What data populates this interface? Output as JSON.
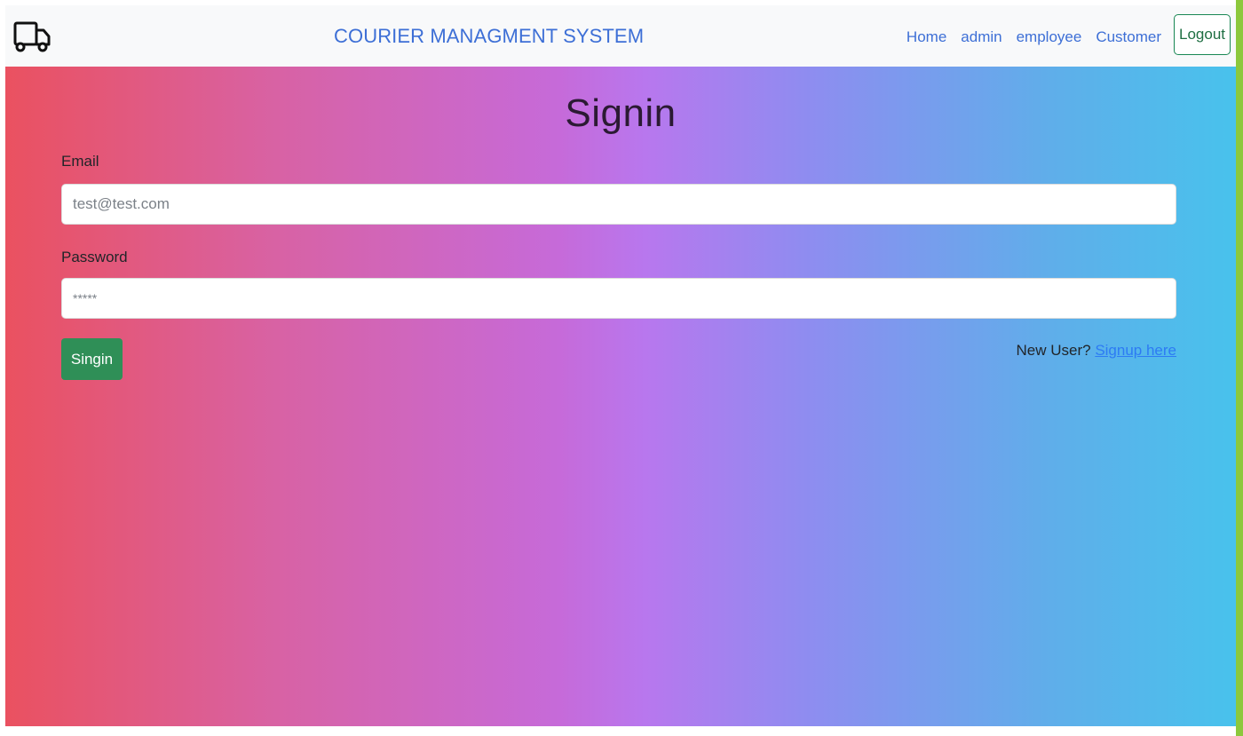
{
  "navbar": {
    "brand": "COURIER MANAGMENT SYSTEM",
    "links": [
      "Home",
      "admin",
      "employee",
      "Customer"
    ],
    "logout_label": "Logout",
    "logo_icon": "truck-icon"
  },
  "form": {
    "title": "Signin",
    "email_label": "Email",
    "email_placeholder": "test@test.com",
    "password_label": "Password",
    "password_placeholder": "*****",
    "submit_label": "Singin",
    "new_user_text": "New User? ",
    "signup_link": "Signup here"
  },
  "colors": {
    "brand": "#3d6fd6",
    "submit": "#2f8f57",
    "link": "#2d7bf4",
    "gradient_start": "#ea5160",
    "gradient_mid": "#c66ad9",
    "gradient_end": "#48c2ec"
  }
}
